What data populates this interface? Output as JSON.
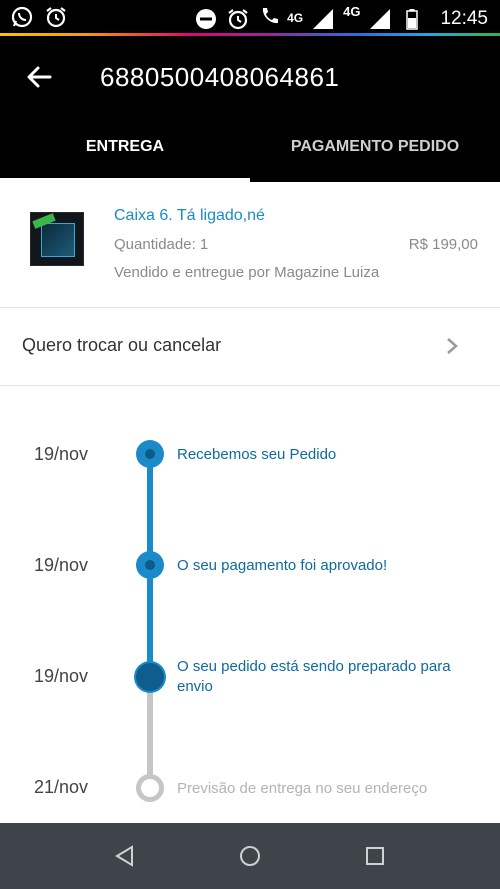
{
  "status_bar": {
    "time": "12:45",
    "network_1": "4G",
    "network_2": "4G",
    "icons": [
      "whatsapp-icon",
      "alarm-icon",
      "do-not-disturb-icon",
      "alarm-icon",
      "wifi-call-icon",
      "signal-icon",
      "signal-icon",
      "battery-icon"
    ]
  },
  "header": {
    "title": "6880500408064861",
    "back_icon": "arrow-left-icon"
  },
  "tabs": [
    {
      "label": "ENTREGA",
      "active": true
    },
    {
      "label": "PAGAMENTO PEDIDO",
      "active": false
    }
  ],
  "product": {
    "name": "Caixa 6. Tá ligado,né",
    "quantity": "Quantidade: 1",
    "price": "R$ 199,00",
    "seller": "Vendido e entregue por Magazine Luiza"
  },
  "exchange": {
    "label": "Quero trocar ou cancelar",
    "icon": "chevron-right-icon"
  },
  "timeline": [
    {
      "date": "19/nov",
      "label": "Recebemos seu Pedido",
      "state": "done"
    },
    {
      "date": "19/nov",
      "label": "O seu pagamento foi aprovado!",
      "state": "done"
    },
    {
      "date": "19/nov",
      "label": "O seu pedido está sendo preparado para envio",
      "state": "current"
    },
    {
      "date": "21/nov",
      "label": "Previsão de entrega no seu endereço",
      "state": "pending"
    }
  ],
  "colors": {
    "accent": "#1a8bc8",
    "header_bg": "#000000",
    "nav_bg": "#3e444a",
    "pending": "#c6c6c6"
  },
  "nav": [
    "back-nav-icon",
    "home-nav-icon",
    "recents-nav-icon"
  ]
}
